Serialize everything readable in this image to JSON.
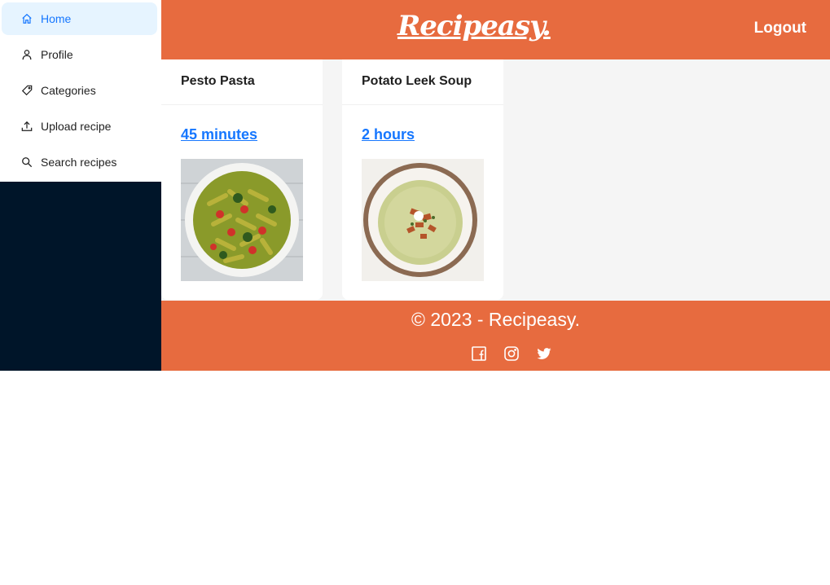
{
  "sidebar": {
    "items": [
      {
        "label": "Home",
        "icon": "home-icon"
      },
      {
        "label": "Profile",
        "icon": "user-icon"
      },
      {
        "label": "Categories",
        "icon": "tag-icon"
      },
      {
        "label": "Upload recipe",
        "icon": "upload-icon"
      },
      {
        "label": "Search recipes",
        "icon": "search-icon"
      }
    ],
    "active_index": 0
  },
  "header": {
    "logo": "Recipeasy.",
    "logout_label": "Logout"
  },
  "recipes": [
    {
      "title": "Pesto Pasta",
      "time": "45 minutes",
      "image": "pesto-pasta-photo"
    },
    {
      "title": "Potato Leek Soup",
      "time": "2 hours",
      "image": "potato-leek-soup-photo"
    }
  ],
  "footer": {
    "copyright": "© 2023 - Recipeasy.",
    "socials": [
      "facebook-icon",
      "instagram-icon",
      "twitter-icon"
    ]
  },
  "colors": {
    "brand": "#e76b3f",
    "sidebar_dark": "#001529",
    "active_bg": "#e6f4ff",
    "link": "#1677ff",
    "content_bg": "#f5f5f5"
  }
}
